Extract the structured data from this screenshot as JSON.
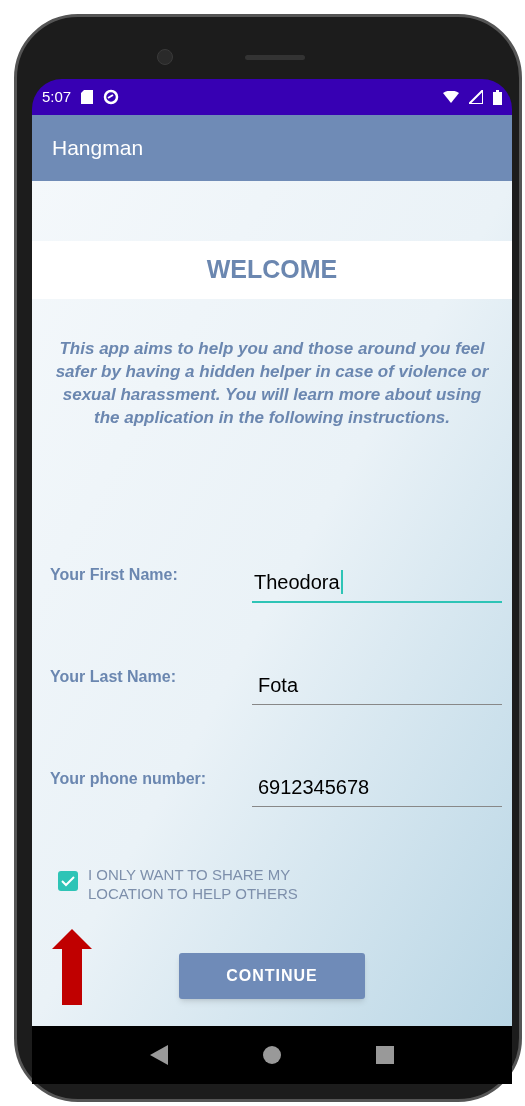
{
  "status_bar": {
    "time": "5:07"
  },
  "app_bar": {
    "title": "Hangman"
  },
  "heading": "WELCOME",
  "intro": "This app aims to help you and those around you feel safer by having a hidden helper in case of violence or sexual harassment. You will learn more about using the application in the following instructions.",
  "fields": [
    {
      "label": "Your First Name:",
      "value": "Theodora",
      "focused": true
    },
    {
      "label": "Your Last Name:",
      "value": "Fota",
      "focused": false
    },
    {
      "label": "Your phone number:",
      "value": "6912345678",
      "focused": false
    }
  ],
  "checkbox": {
    "label": "I ONLY WANT TO SHARE MY LOCATION TO HELP OTHERS",
    "checked": true
  },
  "button": "CONTINUE"
}
